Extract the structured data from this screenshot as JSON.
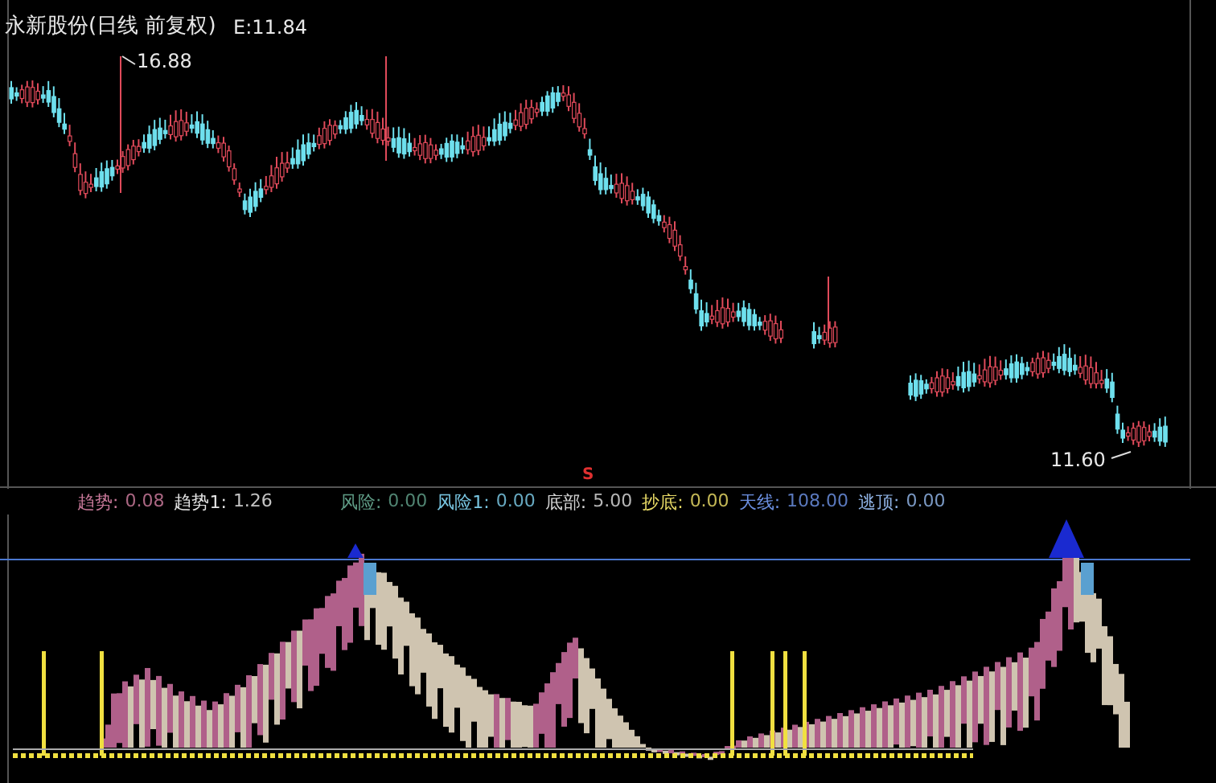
{
  "price_panel": {
    "title": "永新股份(日线 前复权)",
    "price_label": "E:11.84",
    "high_label": "16.88",
    "low_label": "11.60",
    "signal_mark": "S"
  },
  "indicators": [
    {
      "name": "趋势:",
      "value": "0.08",
      "color": "#c9799a"
    },
    {
      "name": "趋势1:",
      "value": "1.26",
      "color": "#e6e6e6"
    },
    {
      "name": "风险:",
      "value": "0.00",
      "color": "#5f9c86"
    },
    {
      "name": "风险1:",
      "value": "0.00",
      "color": "#79c6e2"
    },
    {
      "name": "底部:",
      "value": "5.00",
      "color": "#d6d6d6"
    },
    {
      "name": "抄底:",
      "value": "0.00",
      "color": "#e6d865"
    },
    {
      "name": "天线:",
      "value": "108.00",
      "color": "#6b8fe0"
    },
    {
      "name": "逃顶:",
      "value": "0.00",
      "color": "#8fb2e4"
    }
  ]
}
